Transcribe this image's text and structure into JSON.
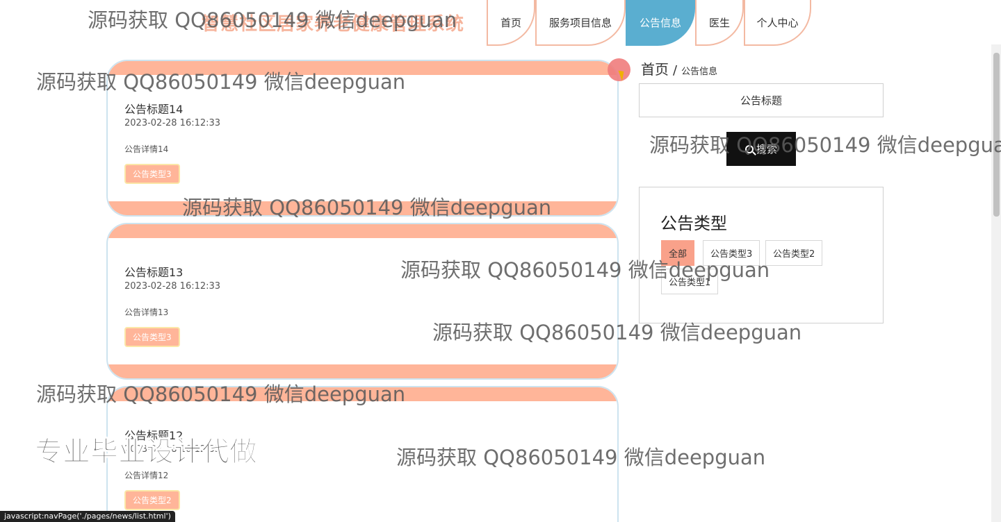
{
  "header": {
    "site_title": "智慧社区居家养老健康管理系统",
    "nav": [
      {
        "label": "首页"
      },
      {
        "label": "服务项目信息"
      },
      {
        "label": "公告信息"
      },
      {
        "label": "医生"
      },
      {
        "label": "个人中心"
      }
    ]
  },
  "breadcrumb": {
    "home": "首页",
    "separator": "/",
    "current": "公告信息"
  },
  "search": {
    "placeholder": "公告标题",
    "button_label": "搜索"
  },
  "types": {
    "title": "公告类型",
    "items": [
      {
        "label": "全部",
        "active": true
      },
      {
        "label": "公告类型3"
      },
      {
        "label": "公告类型2"
      },
      {
        "label": "公告类型1"
      }
    ]
  },
  "cards": [
    {
      "title": "公告标题14",
      "time": "2023-02-28 16:12:33",
      "desc": "公告详情14",
      "tag": "公告类型3"
    },
    {
      "title": "公告标题13",
      "time": "2023-02-28 16:12:33",
      "desc": "公告详情13",
      "tag": "公告类型3"
    },
    {
      "title": "公告标题12",
      "time": "2023-02-28 16:12:33",
      "desc": "公告详情12",
      "tag": "公告类型2"
    }
  ],
  "status_bar": "javascript:navPage('./pages/news/list.html')",
  "watermarks": {
    "text": "源码获取 QQ86050149 微信deepguan",
    "promo": "专业毕业设计代做"
  },
  "colors": {
    "accent": "#ffb599",
    "active_nav": "#5aaed0",
    "search_button": "#111111",
    "active_type": "#f9a18a"
  }
}
